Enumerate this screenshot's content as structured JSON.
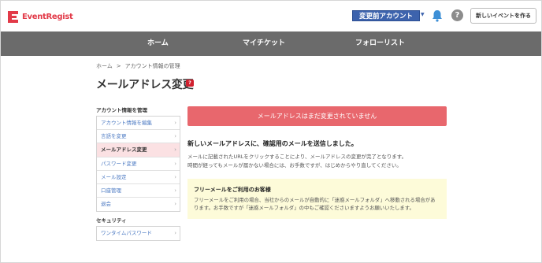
{
  "header": {
    "logo_text": "EventRegist",
    "account_label": "変更前アカウント",
    "help_symbol": "?",
    "create_event_label": "新しいイベントを作る"
  },
  "nav": {
    "items": [
      {
        "label": "ホーム"
      },
      {
        "label": "マイチケット"
      },
      {
        "label": "フォローリスト"
      }
    ]
  },
  "breadcrumb": {
    "home": "ホーム",
    "separator": ">",
    "current": "アカウント情報の管理"
  },
  "page": {
    "title": "メールアドレス変更",
    "help_badge": "?"
  },
  "sidebar": {
    "account_heading": "アカウント情報を管理",
    "account_items": [
      {
        "label": "アカウント情報を編集"
      },
      {
        "label": "言語を変更"
      },
      {
        "label": "メールアドレス変更",
        "active": true
      },
      {
        "label": "パスワード変更"
      },
      {
        "label": "メール設定"
      },
      {
        "label": "口座管理"
      },
      {
        "label": "退会"
      }
    ],
    "security_heading": "セキュリティ",
    "security_items": [
      {
        "label": "ワンタイムパスワード"
      }
    ],
    "chevron": "›"
  },
  "main": {
    "alert": "メールアドレスはまだ変更されていません",
    "message_title": "新しいメールアドレスに、確認用のメールを送信しました。",
    "message_line1": "メールに記載されたURLをクリックすることにより、メールアドレスの変更が完了となります。",
    "message_line2": "時間が経ってもメールが届かない場合には、お手数ですが、はじめからやり直してください。",
    "notice_title": "フリーメールをご利用のお客様",
    "notice_line1": "フリーメールをご利用の場合、当社からのメールが自動的に「迷惑メールフォルダ」へ移動される場合があ",
    "notice_line2": "ります。お手数ですが「迷惑メールフォルダ」の中もご確認くださいますようお願いいたします。"
  },
  "colors": {
    "brand": "#e23a48",
    "account_button": "#3d63ad",
    "nav_bg": "#6b6b6b",
    "alert_bg": "#e8676d",
    "link": "#4a78c2",
    "active_bg": "#fbe1e3",
    "notice_bg": "#fdfbd9"
  }
}
